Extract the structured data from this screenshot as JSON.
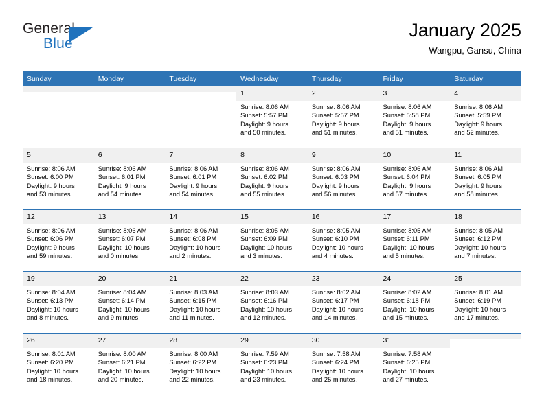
{
  "brand": {
    "general": "General",
    "blue": "Blue",
    "accent_color": "#1f72bd"
  },
  "header": {
    "title": "January 2025",
    "subtitle": "Wangpu, Gansu, China"
  },
  "calendar": {
    "header_bg": "#2e74b5",
    "daynum_bg": "#f0f0f0",
    "weekday_headers": [
      "Sunday",
      "Monday",
      "Tuesday",
      "Wednesday",
      "Thursday",
      "Friday",
      "Saturday"
    ],
    "labels": {
      "sunrise_prefix": "Sunrise:",
      "sunset_prefix": "Sunset:",
      "daylight_prefix": "Daylight:"
    },
    "weeks": [
      [
        {
          "day": "",
          "blank": true
        },
        {
          "day": "",
          "blank": true
        },
        {
          "day": "",
          "blank": true
        },
        {
          "day": "1",
          "sunrise": "Sunrise: 8:06 AM",
          "sunset": "Sunset: 5:57 PM",
          "daylight1": "Daylight: 9 hours",
          "daylight2": "and 50 minutes."
        },
        {
          "day": "2",
          "sunrise": "Sunrise: 8:06 AM",
          "sunset": "Sunset: 5:57 PM",
          "daylight1": "Daylight: 9 hours",
          "daylight2": "and 51 minutes."
        },
        {
          "day": "3",
          "sunrise": "Sunrise: 8:06 AM",
          "sunset": "Sunset: 5:58 PM",
          "daylight1": "Daylight: 9 hours",
          "daylight2": "and 51 minutes."
        },
        {
          "day": "4",
          "sunrise": "Sunrise: 8:06 AM",
          "sunset": "Sunset: 5:59 PM",
          "daylight1": "Daylight: 9 hours",
          "daylight2": "and 52 minutes."
        }
      ],
      [
        {
          "day": "5",
          "sunrise": "Sunrise: 8:06 AM",
          "sunset": "Sunset: 6:00 PM",
          "daylight1": "Daylight: 9 hours",
          "daylight2": "and 53 minutes."
        },
        {
          "day": "6",
          "sunrise": "Sunrise: 8:06 AM",
          "sunset": "Sunset: 6:01 PM",
          "daylight1": "Daylight: 9 hours",
          "daylight2": "and 54 minutes."
        },
        {
          "day": "7",
          "sunrise": "Sunrise: 8:06 AM",
          "sunset": "Sunset: 6:01 PM",
          "daylight1": "Daylight: 9 hours",
          "daylight2": "and 54 minutes."
        },
        {
          "day": "8",
          "sunrise": "Sunrise: 8:06 AM",
          "sunset": "Sunset: 6:02 PM",
          "daylight1": "Daylight: 9 hours",
          "daylight2": "and 55 minutes."
        },
        {
          "day": "9",
          "sunrise": "Sunrise: 8:06 AM",
          "sunset": "Sunset: 6:03 PM",
          "daylight1": "Daylight: 9 hours",
          "daylight2": "and 56 minutes."
        },
        {
          "day": "10",
          "sunrise": "Sunrise: 8:06 AM",
          "sunset": "Sunset: 6:04 PM",
          "daylight1": "Daylight: 9 hours",
          "daylight2": "and 57 minutes."
        },
        {
          "day": "11",
          "sunrise": "Sunrise: 8:06 AM",
          "sunset": "Sunset: 6:05 PM",
          "daylight1": "Daylight: 9 hours",
          "daylight2": "and 58 minutes."
        }
      ],
      [
        {
          "day": "12",
          "sunrise": "Sunrise: 8:06 AM",
          "sunset": "Sunset: 6:06 PM",
          "daylight1": "Daylight: 9 hours",
          "daylight2": "and 59 minutes."
        },
        {
          "day": "13",
          "sunrise": "Sunrise: 8:06 AM",
          "sunset": "Sunset: 6:07 PM",
          "daylight1": "Daylight: 10 hours",
          "daylight2": "and 0 minutes."
        },
        {
          "day": "14",
          "sunrise": "Sunrise: 8:06 AM",
          "sunset": "Sunset: 6:08 PM",
          "daylight1": "Daylight: 10 hours",
          "daylight2": "and 2 minutes."
        },
        {
          "day": "15",
          "sunrise": "Sunrise: 8:05 AM",
          "sunset": "Sunset: 6:09 PM",
          "daylight1": "Daylight: 10 hours",
          "daylight2": "and 3 minutes."
        },
        {
          "day": "16",
          "sunrise": "Sunrise: 8:05 AM",
          "sunset": "Sunset: 6:10 PM",
          "daylight1": "Daylight: 10 hours",
          "daylight2": "and 4 minutes."
        },
        {
          "day": "17",
          "sunrise": "Sunrise: 8:05 AM",
          "sunset": "Sunset: 6:11 PM",
          "daylight1": "Daylight: 10 hours",
          "daylight2": "and 5 minutes."
        },
        {
          "day": "18",
          "sunrise": "Sunrise: 8:05 AM",
          "sunset": "Sunset: 6:12 PM",
          "daylight1": "Daylight: 10 hours",
          "daylight2": "and 7 minutes."
        }
      ],
      [
        {
          "day": "19",
          "sunrise": "Sunrise: 8:04 AM",
          "sunset": "Sunset: 6:13 PM",
          "daylight1": "Daylight: 10 hours",
          "daylight2": "and 8 minutes."
        },
        {
          "day": "20",
          "sunrise": "Sunrise: 8:04 AM",
          "sunset": "Sunset: 6:14 PM",
          "daylight1": "Daylight: 10 hours",
          "daylight2": "and 9 minutes."
        },
        {
          "day": "21",
          "sunrise": "Sunrise: 8:03 AM",
          "sunset": "Sunset: 6:15 PM",
          "daylight1": "Daylight: 10 hours",
          "daylight2": "and 11 minutes."
        },
        {
          "day": "22",
          "sunrise": "Sunrise: 8:03 AM",
          "sunset": "Sunset: 6:16 PM",
          "daylight1": "Daylight: 10 hours",
          "daylight2": "and 12 minutes."
        },
        {
          "day": "23",
          "sunrise": "Sunrise: 8:02 AM",
          "sunset": "Sunset: 6:17 PM",
          "daylight1": "Daylight: 10 hours",
          "daylight2": "and 14 minutes."
        },
        {
          "day": "24",
          "sunrise": "Sunrise: 8:02 AM",
          "sunset": "Sunset: 6:18 PM",
          "daylight1": "Daylight: 10 hours",
          "daylight2": "and 15 minutes."
        },
        {
          "day": "25",
          "sunrise": "Sunrise: 8:01 AM",
          "sunset": "Sunset: 6:19 PM",
          "daylight1": "Daylight: 10 hours",
          "daylight2": "and 17 minutes."
        }
      ],
      [
        {
          "day": "26",
          "sunrise": "Sunrise: 8:01 AM",
          "sunset": "Sunset: 6:20 PM",
          "daylight1": "Daylight: 10 hours",
          "daylight2": "and 18 minutes."
        },
        {
          "day": "27",
          "sunrise": "Sunrise: 8:00 AM",
          "sunset": "Sunset: 6:21 PM",
          "daylight1": "Daylight: 10 hours",
          "daylight2": "and 20 minutes."
        },
        {
          "day": "28",
          "sunrise": "Sunrise: 8:00 AM",
          "sunset": "Sunset: 6:22 PM",
          "daylight1": "Daylight: 10 hours",
          "daylight2": "and 22 minutes."
        },
        {
          "day": "29",
          "sunrise": "Sunrise: 7:59 AM",
          "sunset": "Sunset: 6:23 PM",
          "daylight1": "Daylight: 10 hours",
          "daylight2": "and 23 minutes."
        },
        {
          "day": "30",
          "sunrise": "Sunrise: 7:58 AM",
          "sunset": "Sunset: 6:24 PM",
          "daylight1": "Daylight: 10 hours",
          "daylight2": "and 25 minutes."
        },
        {
          "day": "31",
          "sunrise": "Sunrise: 7:58 AM",
          "sunset": "Sunset: 6:25 PM",
          "daylight1": "Daylight: 10 hours",
          "daylight2": "and 27 minutes."
        },
        {
          "day": "",
          "blank": true
        }
      ]
    ]
  }
}
